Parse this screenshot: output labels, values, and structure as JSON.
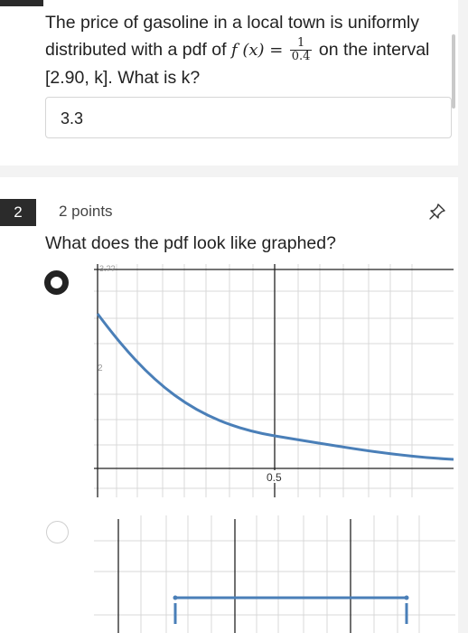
{
  "question1": {
    "text_before": "The price of gasoline in a local town is uniformly distributed with a pdf of",
    "func_label": "f (x) =",
    "frac_num": "1",
    "frac_den": "0.4",
    "text_after": "on the interval [2.90, k]. What is k?",
    "answer": "3.3"
  },
  "question2": {
    "number": "2",
    "points": "2 points",
    "prompt": "What does the pdf look like graphed?",
    "options": [
      {
        "selected": true
      },
      {
        "selected": false
      }
    ]
  },
  "graph1": {
    "y_top_label": "3.??",
    "y_mid_label": "2",
    "x_label": "0.5"
  },
  "colors": {
    "curve": "#4a7fb8",
    "badge": "#2b2b2b",
    "grid": "#d9d9d9",
    "axis": "#222222"
  }
}
